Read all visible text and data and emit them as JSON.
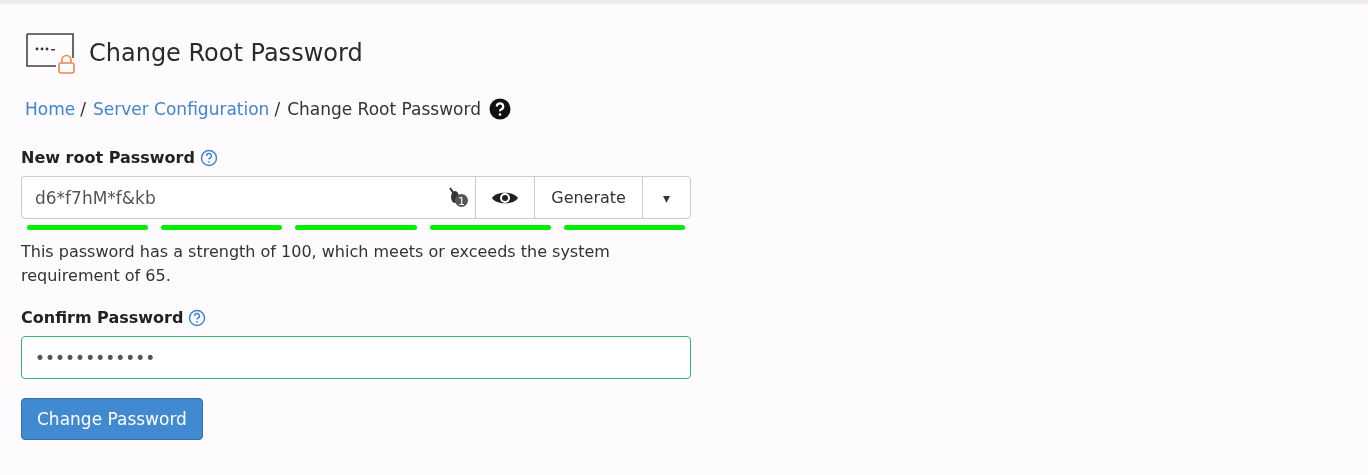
{
  "page": {
    "title": "Change Root Password"
  },
  "breadcrumb": [
    {
      "label": "Home",
      "kind": "link",
      "separator": "/"
    },
    {
      "label": "Server Configuration",
      "kind": "link",
      "separator": "/"
    },
    {
      "label": "Change Root Password",
      "kind": "current"
    }
  ],
  "new_password": {
    "label": "New root Password",
    "value": "d6*f7hM*f&kb",
    "generate_button": "Generate",
    "dropdown_icon": "▾",
    "badge": "1"
  },
  "strength_meter": {
    "segments": [
      {
        "filled": true
      },
      {
        "filled": true
      },
      {
        "filled": true
      },
      {
        "filled": true
      },
      {
        "filled": true
      }
    ]
  },
  "strength_message": "This password has a strength of 100, which meets or exceeds the system requirement of 65.",
  "confirm_password": {
    "label": "Confirm Password",
    "value": "••••••••••••",
    "valid": true
  },
  "submit_button": "Change Password"
}
